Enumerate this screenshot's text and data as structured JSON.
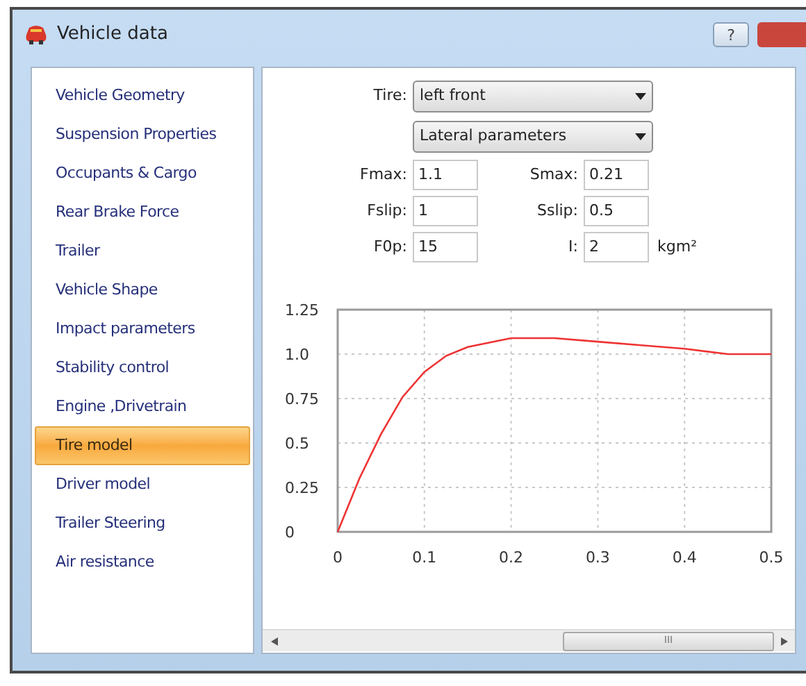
{
  "window": {
    "title": "Vehicle data",
    "help_button": "?"
  },
  "sidebar": {
    "items": [
      {
        "label": "Vehicle Geometry",
        "selected": false
      },
      {
        "label": "Suspension Properties",
        "selected": false
      },
      {
        "label": "Occupants & Cargo",
        "selected": false
      },
      {
        "label": "Rear Brake Force",
        "selected": false
      },
      {
        "label": "Trailer",
        "selected": false
      },
      {
        "label": "Vehicle Shape",
        "selected": false
      },
      {
        "label": "Impact parameters",
        "selected": false
      },
      {
        "label": "Stability control",
        "selected": false
      },
      {
        "label": "Engine ,Drivetrain",
        "selected": false
      },
      {
        "label": "Tire model",
        "selected": true
      },
      {
        "label": "Driver model",
        "selected": false
      },
      {
        "label": "Trailer Steering",
        "selected": false
      },
      {
        "label": "Air resistance",
        "selected": false
      }
    ]
  },
  "tire": {
    "label": "Tire:",
    "value": "left front"
  },
  "parameter_set": {
    "value": "Lateral parameters"
  },
  "parameters": [
    {
      "label": "Fmax:",
      "value": "1.1"
    },
    {
      "label": "Smax:",
      "value": "0.21"
    },
    {
      "label": "Fslip:",
      "value": "1"
    },
    {
      "label": "Sslip:",
      "value": "0.5"
    },
    {
      "label": "F0p:",
      "value": "15"
    },
    {
      "label": "I:",
      "value": "2",
      "unit": "kgm²"
    }
  ],
  "chart_data": {
    "type": "line",
    "x": [
      0,
      0.025,
      0.05,
      0.075,
      0.1,
      0.125,
      0.15,
      0.2,
      0.25,
      0.3,
      0.35,
      0.4,
      0.45,
      0.5
    ],
    "grid": true,
    "series": [
      {
        "color": "#ee3333",
        "values": [
          0,
          0.3,
          0.55,
          0.76,
          0.9,
          0.99,
          1.04,
          1.09,
          1.09,
          1.07,
          1.05,
          1.03,
          1.0,
          1.0
        ]
      }
    ],
    "xlim": [
      0,
      0.5
    ],
    "ylim": [
      0,
      1.25
    ],
    "xticks": [
      0,
      0.1,
      0.2,
      0.3,
      0.4,
      0.5
    ],
    "yticks": [
      0,
      0.25,
      0.5,
      0.75,
      {
        "value": 1,
        "label": "1.0"
      },
      1.25
    ]
  },
  "scrollbar": {
    "grip": "III"
  }
}
